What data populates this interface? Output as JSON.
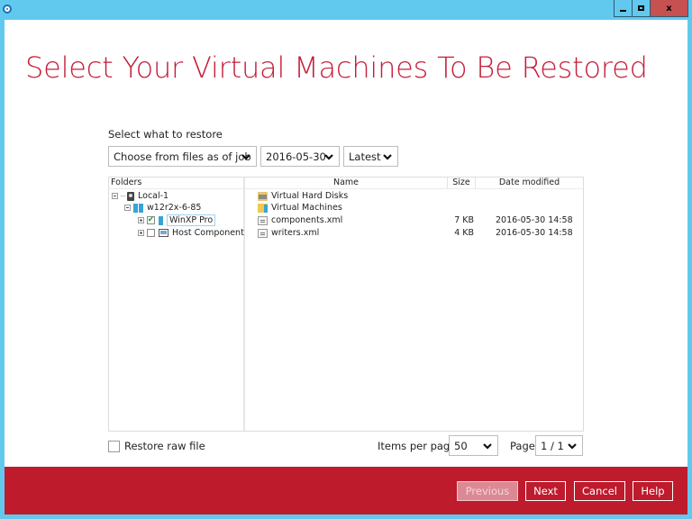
{
  "window": {
    "title": "",
    "controls": {
      "minimize": "minimize",
      "maximize": "maximize",
      "close": "x"
    },
    "colors": {
      "frame": "#62c9ee",
      "accent": "#c41e3a",
      "footer": "#be1b2d"
    }
  },
  "page": {
    "title": "Select Your Virtual Machines To Be Restored"
  },
  "restore": {
    "label": "Select what to restore",
    "mode_select": "Choose from files as of job",
    "date_select": "2016-05-30",
    "version_select": "Latest"
  },
  "folders": {
    "header": "Folders",
    "tree": [
      {
        "label": "Local-1",
        "icon": "local-drive-icon",
        "level": 0,
        "expander": "minus"
      },
      {
        "label": "w12r2x-6-85",
        "icon": "server-icon",
        "level": 1,
        "expander": "minus"
      },
      {
        "label": "WinXP Pro",
        "icon": "vm-icon",
        "level": 2,
        "expander": "plus",
        "checked": true,
        "selected": true
      },
      {
        "label": "Host Component",
        "icon": "host-component-icon",
        "level": 2,
        "expander": "plus",
        "checked": false
      }
    ]
  },
  "files": {
    "columns": {
      "name": "Name",
      "size": "Size",
      "date": "Date modified"
    },
    "rows": [
      {
        "name": "Virtual Hard Disks",
        "icon": "hard-disk-folder-icon",
        "size": "",
        "date": ""
      },
      {
        "name": "Virtual Machines",
        "icon": "vm-folder-icon",
        "size": "",
        "date": ""
      },
      {
        "name": "components.xml",
        "icon": "xml-file-icon",
        "size": "7 KB",
        "date": "2016-05-30 14:58"
      },
      {
        "name": "writers.xml",
        "icon": "xml-file-icon",
        "size": "4 KB",
        "date": "2016-05-30 14:58"
      }
    ]
  },
  "options": {
    "restore_raw_label": "Restore raw file",
    "restore_raw_checked": false,
    "items_per_page_label": "Items per page",
    "items_per_page": "50",
    "page_label": "Page",
    "page": "1 / 1"
  },
  "footer": {
    "previous": "Previous",
    "next": "Next",
    "cancel": "Cancel",
    "help": "Help"
  }
}
